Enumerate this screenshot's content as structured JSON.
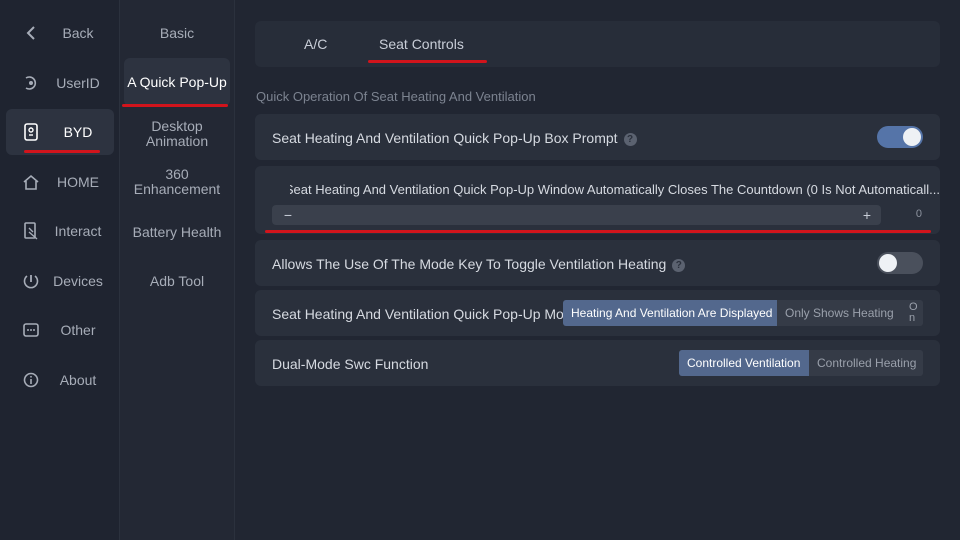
{
  "nav_primary": {
    "back": "Back",
    "items": [
      {
        "label": "UserID"
      },
      {
        "label": "BYD"
      },
      {
        "label": "HOME"
      },
      {
        "label": "Interact"
      },
      {
        "label": "Devices"
      },
      {
        "label": "Other"
      },
      {
        "label": "About"
      }
    ],
    "active": "BYD"
  },
  "nav_secondary": {
    "items": [
      {
        "label": "Basic"
      },
      {
        "label": "A Quick Pop-Up"
      },
      {
        "label": "Desktop Animation"
      },
      {
        "label": "360 Enhancement"
      },
      {
        "label": "Battery Health"
      },
      {
        "label": "Adb Tool"
      }
    ],
    "active": "A Quick Pop-Up"
  },
  "tabs": [
    {
      "label": "A/C"
    },
    {
      "label": "Seat Controls"
    }
  ],
  "active_tab": "Seat Controls",
  "section_title": "Quick Operation Of Seat Heating And Ventilation",
  "settings": {
    "popup_prompt": {
      "label": "Seat Heating And Ventilation Quick Pop-Up Box Prompt",
      "help": "?",
      "enabled": true
    },
    "countdown": {
      "label": "Seat Heating And Ventilation Quick Pop-Up Window Automatically Closes The Countdown (0 Is Not Automaticall...",
      "minus": "−",
      "plus": "+",
      "value": "0"
    },
    "mode_key": {
      "label": "Allows The Use Of The Mode Key To Toggle Ventilation Heating",
      "help": "?",
      "enabled": false
    },
    "popup_mode": {
      "label": "Seat Heating And Ventilation Quick Pop-Up Mode",
      "options": [
        "Heating And Ventilation Are Displayed",
        "Only Shows Heating",
        "O n"
      ],
      "selected": "Heating And Ventilation Are Displayed"
    },
    "swc": {
      "label": "Dual-Mode Swc Function",
      "options": [
        "Controlled Ventilation",
        "Controlled Heating"
      ],
      "selected": "Controlled Ventilation"
    }
  },
  "colors": {
    "accent": "#5574a8",
    "highlight_red": "#d1141c",
    "background": "#1f2430",
    "card": "#2a303c"
  }
}
